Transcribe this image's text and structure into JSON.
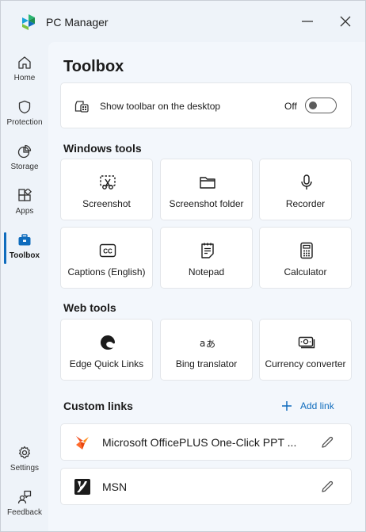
{
  "app": {
    "title": "PC Manager"
  },
  "window_controls": {
    "minimize_icon": "minimize-icon",
    "close_icon": "close-icon"
  },
  "sidebar": {
    "items": [
      {
        "label": "Home",
        "icon": "home-icon"
      },
      {
        "label": "Protection",
        "icon": "shield-icon"
      },
      {
        "label": "Storage",
        "icon": "pie-chart-icon"
      },
      {
        "label": "Apps",
        "icon": "apps-icon"
      },
      {
        "label": "Toolbox",
        "icon": "toolbox-icon",
        "active": true
      }
    ],
    "bottom_items": [
      {
        "label": "Settings",
        "icon": "gear-icon"
      },
      {
        "label": "Feedback",
        "icon": "feedback-icon"
      }
    ]
  },
  "main": {
    "title": "Toolbox",
    "toolbar_setting": {
      "label": "Show toolbar on the desktop",
      "state": "Off",
      "enabled": false
    },
    "windows_tools": {
      "title": "Windows tools",
      "items": [
        {
          "label": "Screenshot",
          "icon": "screenshot-icon"
        },
        {
          "label": "Screenshot folder",
          "icon": "folder-icon"
        },
        {
          "label": "Recorder",
          "icon": "microphone-icon"
        },
        {
          "label": "Captions (English)",
          "icon": "captions-icon"
        },
        {
          "label": "Notepad",
          "icon": "notepad-icon"
        },
        {
          "label": "Calculator",
          "icon": "calculator-icon"
        }
      ]
    },
    "web_tools": {
      "title": "Web tools",
      "items": [
        {
          "label": "Edge Quick Links",
          "icon": "edge-icon"
        },
        {
          "label": "Bing translator",
          "icon": "translator-icon"
        },
        {
          "label": "Currency converter",
          "icon": "currency-icon"
        }
      ]
    },
    "custom_links": {
      "title": "Custom links",
      "add_label": "Add link",
      "items": [
        {
          "label": "Microsoft OfficePLUS One-Click PPT ...",
          "icon": "officeplus-icon"
        },
        {
          "label": "MSN",
          "icon": "msn-icon"
        }
      ]
    }
  },
  "colors": {
    "accent": "#0f6cbd",
    "background": "#eef3f9",
    "card": "#ffffff"
  }
}
